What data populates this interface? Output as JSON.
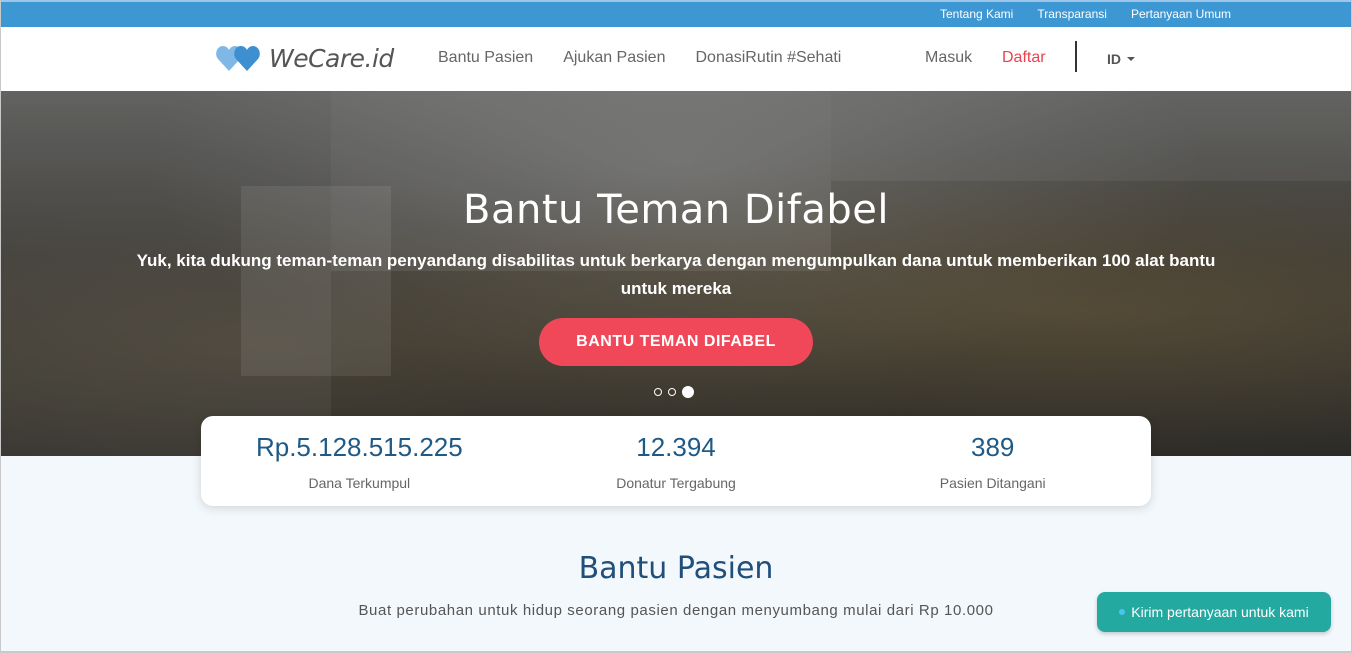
{
  "topbar": {
    "links": [
      "Tentang Kami",
      "Transparansi",
      "Pertanyaan Umum"
    ]
  },
  "navbar": {
    "logo_text": "WeCare.id",
    "links": [
      "Bantu Pasien",
      "Ajukan Pasien",
      "DonasiRutin #Sehati"
    ],
    "login": "Masuk",
    "register": "Daftar",
    "language": "ID"
  },
  "hero": {
    "title": "Bantu Teman Difabel",
    "subtitle": "Yuk, kita dukung teman-teman penyandang disabilitas untuk berkarya dengan mengumpulkan dana untuk memberikan 100 alat bantu untuk mereka",
    "button": "BANTU TEMAN DIFABEL",
    "slide_count": 3,
    "active_slide": 3
  },
  "stats": [
    {
      "value": "Rp.5.128.515.225",
      "label": "Dana Terkumpul"
    },
    {
      "value": "12.394",
      "label": "Donatur Tergabung"
    },
    {
      "value": "389",
      "label": "Pasien Ditangani"
    }
  ],
  "section": {
    "title": "Bantu Pasien",
    "subtitle": "Buat perubahan untuk hidup seorang pasien dengan menyumbang mulai dari Rp 10.000"
  },
  "chat": {
    "label": "Kirim pertanyaan untuk kami"
  },
  "colors": {
    "topbar": "#3d97d3",
    "accent_red": "#f04858",
    "stat_value": "#1f5a86",
    "chat": "#24a9a0"
  }
}
